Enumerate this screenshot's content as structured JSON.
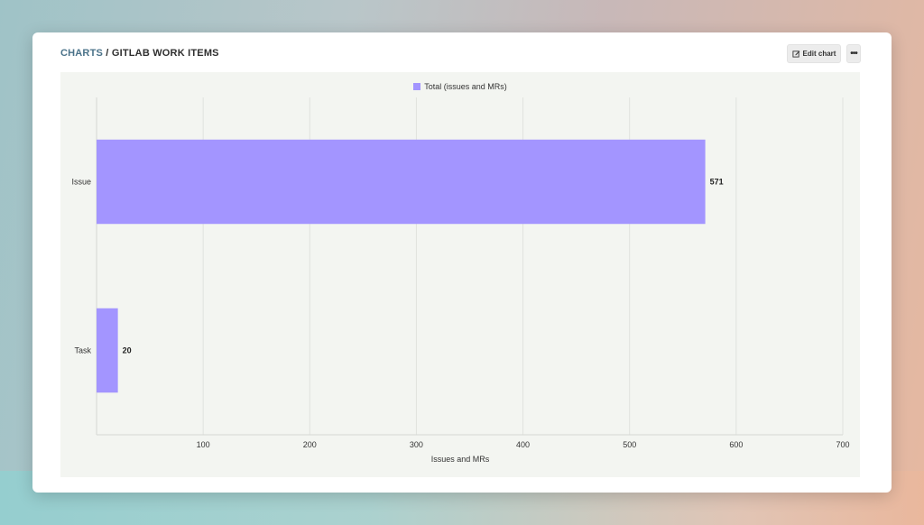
{
  "breadcrumb": {
    "root": "CHARTS",
    "separator": " / ",
    "current": "GITLAB WORK ITEMS"
  },
  "actions": {
    "edit_label": "Edit chart",
    "edit_icon": "edit-icon",
    "more_label": "•••",
    "more_icon": "more-icon"
  },
  "colors": {
    "bar": "#a395ff",
    "accent_link": "#4a7289",
    "chart_bg": "#f3f5f1",
    "grid": "#e0e2de"
  },
  "chart_data": {
    "type": "bar",
    "orientation": "horizontal",
    "categories": [
      "Issue",
      "Task"
    ],
    "series": [
      {
        "name": "Total (issues and MRs)",
        "values": [
          571,
          20
        ]
      }
    ],
    "data_labels": [
      "571",
      "20"
    ],
    "xlabel": "Issues and MRs",
    "ylabel": "",
    "xlim": [
      0,
      700
    ],
    "xticks": [
      100,
      200,
      300,
      400,
      500,
      600,
      700
    ],
    "grid": "vertical",
    "legend": "top-center"
  }
}
